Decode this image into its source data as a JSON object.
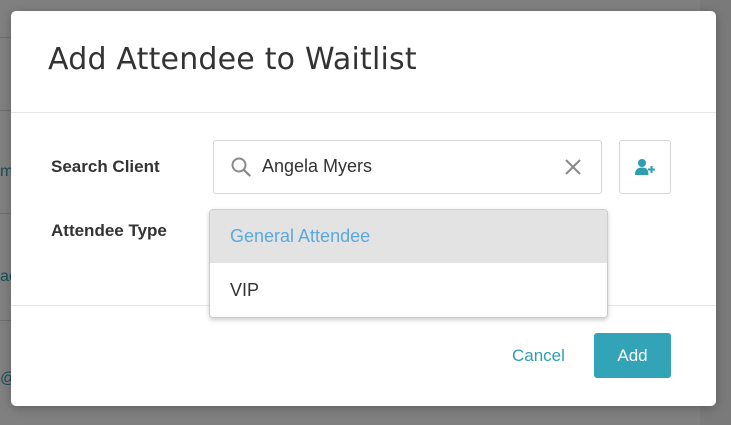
{
  "background": {
    "fragments": [
      "me",
      "ac",
      "@"
    ]
  },
  "modal": {
    "title": "Add Attendee to Waitlist",
    "search_client": {
      "label": "Search Client",
      "value": "Angela Myers"
    },
    "attendee_type": {
      "label": "Attendee Type",
      "options": [
        "General Attendee",
        "VIP"
      ],
      "highlighted": "General Attendee"
    },
    "footer": {
      "cancel_label": "Cancel",
      "add_label": "Add"
    }
  },
  "colors": {
    "accent": "#33a3b7",
    "link": "#2e9db2",
    "highlight_text": "#5aa9dd"
  },
  "icons": {
    "search": "search-icon",
    "clear": "close-icon",
    "add_client": "add-user-icon"
  }
}
